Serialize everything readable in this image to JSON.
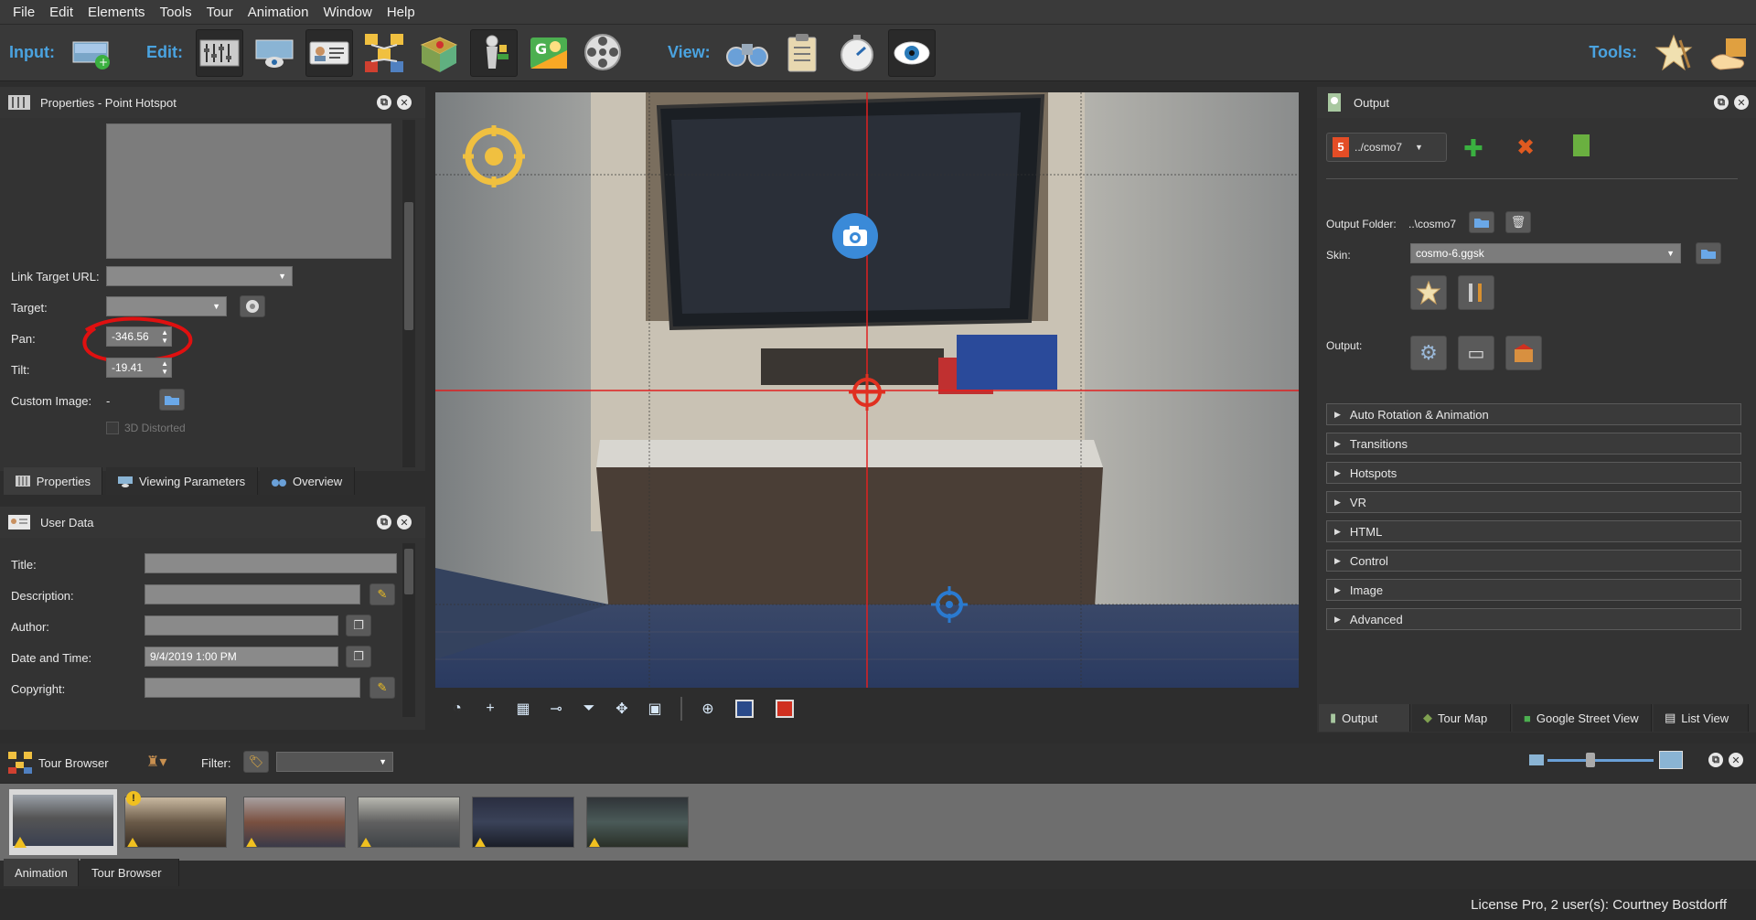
{
  "menu": [
    "File",
    "Edit",
    "Elements",
    "Tools",
    "Tour",
    "Animation",
    "Window",
    "Help"
  ],
  "toolbar": {
    "input_label": "Input:",
    "edit_label": "Edit:",
    "view_label": "View:",
    "tools_label": "Tools:"
  },
  "properties_panel": {
    "title": "Properties - Point Hotspot",
    "link_target_url_label": "Link Target URL:",
    "target_label": "Target:",
    "pan_label": "Pan:",
    "pan_value": "-346.56",
    "tilt_label": "Tilt:",
    "tilt_value": "-19.41",
    "custom_image_label": "Custom Image:",
    "custom_image_value": "-",
    "distorted_label": "3D Distorted",
    "tabs": [
      "Properties",
      "Viewing Parameters",
      "Overview"
    ]
  },
  "user_data_panel": {
    "title": "User Data",
    "title_label": "Title:",
    "description_label": "Description:",
    "author_label": "Author:",
    "datetime_label": "Date and Time:",
    "datetime_value": "9/4/2019 1:00 PM",
    "copyright_label": "Copyright:"
  },
  "output_panel": {
    "title": "Output",
    "format_label": "../cosmo7",
    "output_folder_label": "Output Folder:",
    "output_folder_value": "..\\cosmo7",
    "skin_label": "Skin:",
    "skin_value": "cosmo-6.ggsk",
    "output_label": "Output:",
    "sections": [
      "Auto Rotation & Animation",
      "Transitions",
      "Hotspots",
      "VR",
      "HTML",
      "Control",
      "Image",
      "Advanced"
    ],
    "tabs": [
      "Output",
      "Tour Map",
      "Google Street View",
      "List View"
    ]
  },
  "tour_browser": {
    "title": "Tour Browser",
    "filter_label": "Filter:",
    "tabs": [
      "Animation",
      "Tour Browser"
    ],
    "thumb_count": 6
  },
  "status": {
    "license": "License Pro, 2 user(s): Courtney Bostdorff"
  },
  "colors": {
    "accent": "#4aa3e0",
    "guide_line": "#e02020",
    "annotation": "#e01010"
  }
}
